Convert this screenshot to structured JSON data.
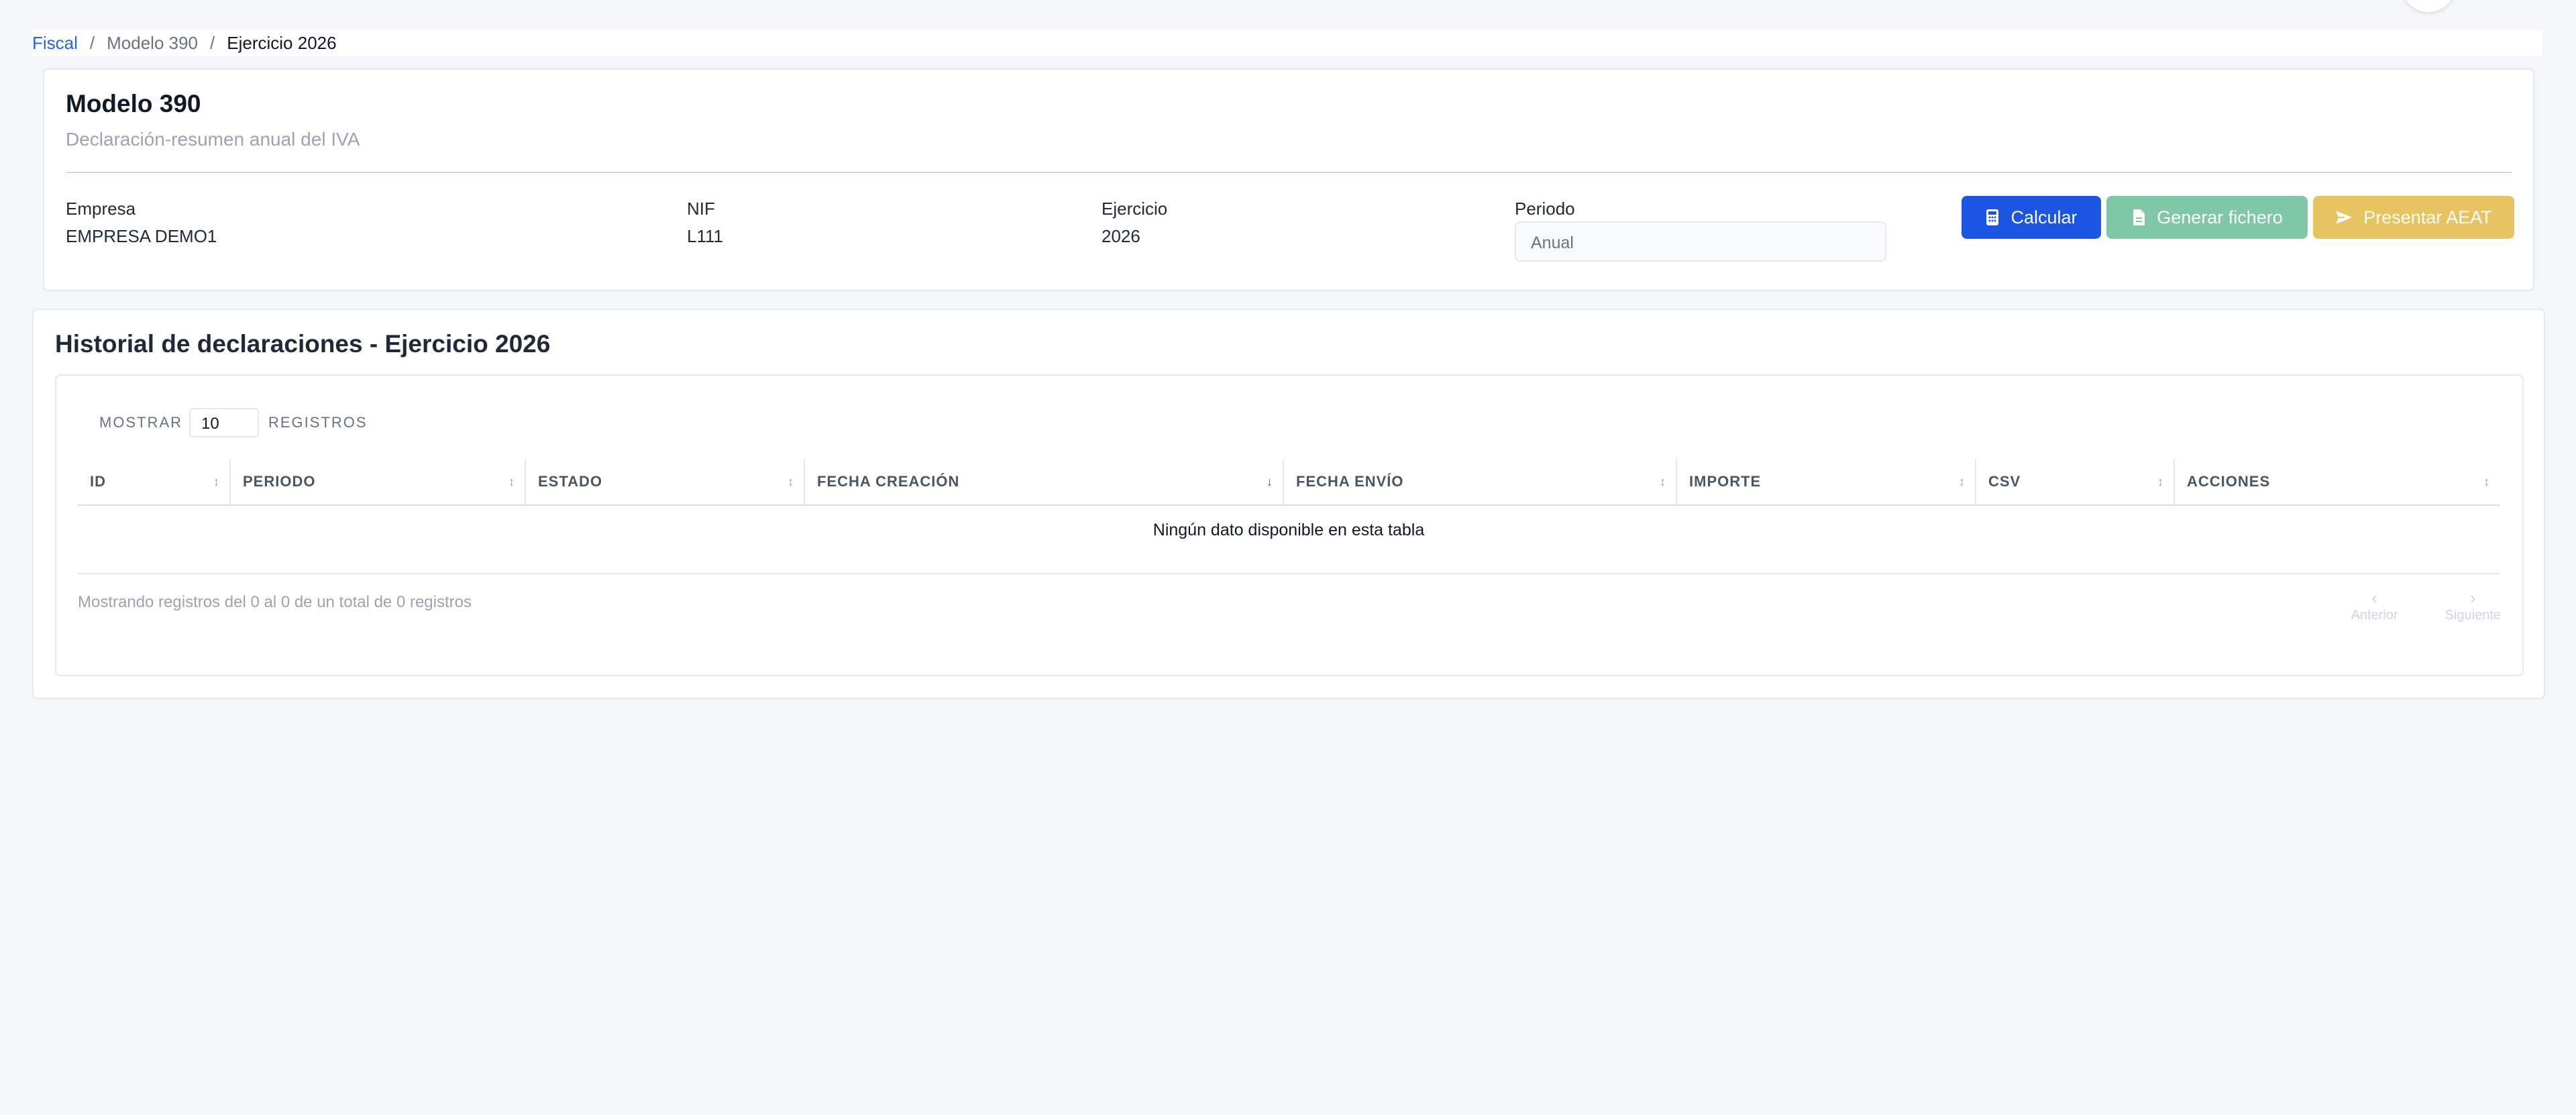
{
  "breadcrumb": {
    "items": [
      "Fiscal",
      "Modelo 390",
      "Ejercicio 2026"
    ],
    "separator": "/"
  },
  "header": {
    "title": "Modelo 390",
    "subtitle": "Declaración-resumen anual del IVA",
    "fields": {
      "empresa_label": "Empresa",
      "empresa_value": "EMPRESA DEMO1",
      "nif_label": "NIF",
      "nif_value": "L111",
      "ejercicio_label": "Ejercicio",
      "ejercicio_value": "2026",
      "periodo_label": "Periodo",
      "periodo_value": "Anual"
    },
    "buttons": {
      "calcular": "Calcular",
      "generar": "Generar fichero",
      "presentar": "Presentar AEAT"
    }
  },
  "historial": {
    "title": "Historial de declaraciones - Ejercicio 2026",
    "length": {
      "prefix": "MOSTRAR",
      "value": "10",
      "suffix": "REGISTROS"
    },
    "columns": [
      "ID",
      "PERIODO",
      "ESTADO",
      "FECHA CREACIÓN",
      "FECHA ENVÍO",
      "IMPORTE",
      "CSV",
      "ACCIONES"
    ],
    "empty": "Ningún dato disponible en esta tabla",
    "info": "Mostrando registros del 0 al 0 de un total de 0 registros",
    "pager": {
      "prev": "Anterior",
      "next": "Siguiente"
    }
  },
  "colors": {
    "primary": "#1d55e3",
    "success_disabled": "#7fc7a6",
    "warning_disabled": "#e7c361",
    "link": "#2563eb"
  }
}
